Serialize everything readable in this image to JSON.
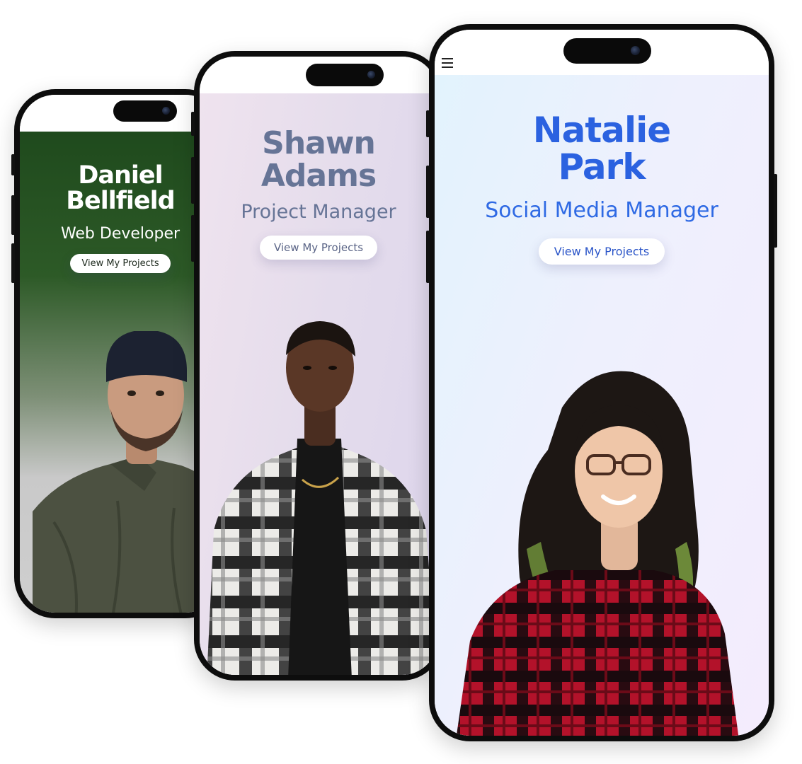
{
  "profiles": [
    {
      "name_line1": "Daniel",
      "name_line2": "Bellfield",
      "role": "Web Developer",
      "cta": "View My Projects",
      "colors": {
        "accent": "#ffffff",
        "bg_top": "#1f4a1d",
        "bg_bottom": "#cfcfcf"
      }
    },
    {
      "name_line1": "Shawn",
      "name_line2": "Adams",
      "role": "Project Manager",
      "cta": "View My Projects",
      "colors": {
        "accent": "#667496",
        "bg_top": "#efe3ee",
        "bg_bottom": "#ddd5ec"
      }
    },
    {
      "name_line1": "Natalie",
      "name_line2": "Park",
      "role": "Social Media Manager",
      "cta": "View My Projects",
      "colors": {
        "accent": "#2b62e0",
        "bg_top": "#e2f3fd",
        "bg_bottom": "#f4ecfd"
      }
    }
  ],
  "icons": {
    "menu": "hamburger-menu-icon",
    "camera": "front-camera-icon"
  }
}
